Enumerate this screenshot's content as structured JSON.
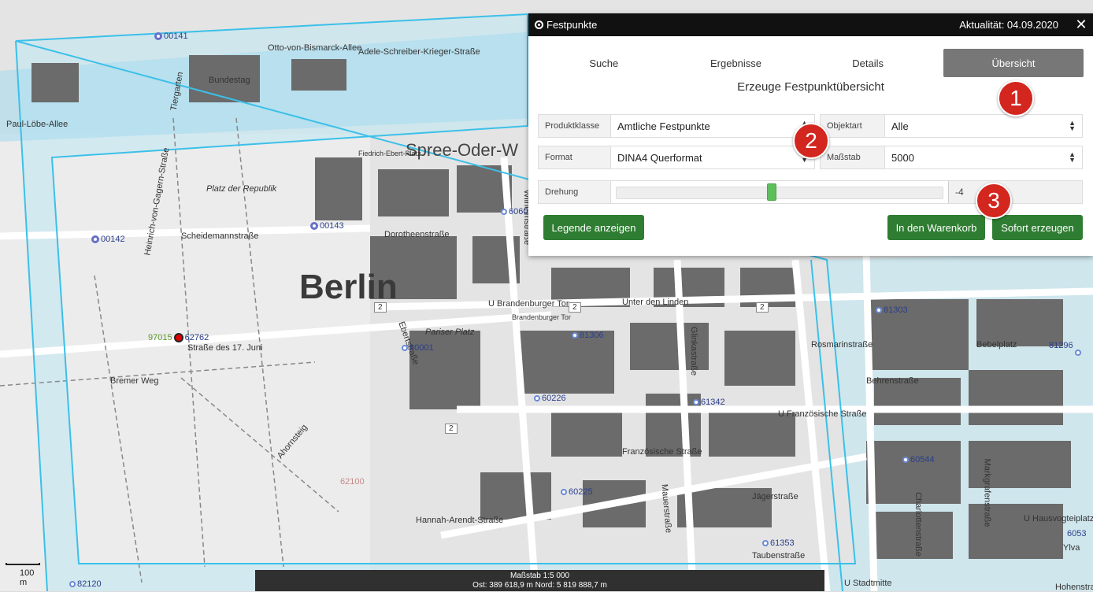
{
  "map": {
    "city_label": "Berlin",
    "street_labels": [
      "Paul-Löbe-Allee",
      "Scheidemannstraße",
      "Dorotheenstraße",
      "Straße des 17. Juni",
      "Bremer Weg",
      "Hannah-Arendt-Straße",
      "Französische Straße",
      "Jägerstraße",
      "Behrenstraße",
      "Unter den Linden",
      "Wilhelmstraße",
      "Spree-Oder-W",
      "Adele-Schreiber-Krieger-Straße",
      "Ebertstraße",
      "Glinkastraße",
      "Mauerstraße",
      "Taubenstraße",
      "Charlottenstraße",
      "Markgrafenstraße",
      "Bebelplatz",
      "Platz der Republik",
      "Bundestag",
      "Ahornsteig",
      "Fiedrich-Ebert-Platz",
      "Pariser Platz",
      "U Brandenburger Tor",
      "Brandenburger Tor",
      "U Französische Straße",
      "U Hausvogteiplatz",
      "U Stadtmitte",
      "Otto-von-Bismarck-Allee",
      "Tiergarten",
      "Heinrich-von-Gagern-Straße",
      "Hohenstraße",
      "Rosmarinstraße",
      "Ylva"
    ],
    "road_numbers": [
      "2",
      "2",
      "2",
      "2"
    ],
    "points": [
      {
        "id": "00141",
        "type": "large"
      },
      {
        "id": "00143",
        "type": "large"
      },
      {
        "id": "00142",
        "type": "large"
      },
      {
        "id": "62762",
        "type": "red"
      },
      {
        "id": "97015",
        "type": "green"
      },
      {
        "id": "80001",
        "type": "small"
      },
      {
        "id": "81306",
        "type": "small"
      },
      {
        "id": "81303",
        "type": "small"
      },
      {
        "id": "60226",
        "type": "small"
      },
      {
        "id": "61342",
        "type": "small"
      },
      {
        "id": "60225",
        "type": "small"
      },
      {
        "id": "60544",
        "type": "small"
      },
      {
        "id": "61353",
        "type": "small"
      },
      {
        "id": "81296",
        "type": "small"
      },
      {
        "id": "82120",
        "type": "small"
      },
      {
        "id": "6060",
        "type": "small"
      },
      {
        "id": "6053",
        "type": "small"
      },
      {
        "id": "62100",
        "type": "small"
      }
    ]
  },
  "panel": {
    "title": "Festpunkte",
    "date_info": "Aktualität: 04.09.2020",
    "close": "✕",
    "tabs": [
      {
        "label": "Suche",
        "active": false
      },
      {
        "label": "Ergebnisse",
        "active": false
      },
      {
        "label": "Details",
        "active": false
      },
      {
        "label": "Übersicht",
        "active": true
      }
    ],
    "section_title": "Erzeuge Festpunktübersicht",
    "fields": {
      "produktklasse": {
        "label": "Produktklasse",
        "value": "Amtliche Festpunkte"
      },
      "objektart": {
        "label": "Objektart",
        "value": "Alle"
      },
      "format": {
        "label": "Format",
        "value": "DINA4 Querformat"
      },
      "massstab": {
        "label": "Maßstab",
        "value": "5000"
      }
    },
    "drehung": {
      "label": "Drehung",
      "value": "-4",
      "slider_fraction": 0.475
    },
    "buttons": {
      "legende": "Legende anzeigen",
      "warenkorb": "In den Warenkorb",
      "sofort": "Sofort erzeugen"
    }
  },
  "markers": [
    "1",
    "2",
    "3"
  ],
  "status": {
    "scale": "Maßstab 1:5 000",
    "coords": "Ost: 389 618,9 m Nord: 5 819 888,7 m"
  },
  "scalebar": "100 m",
  "colors": {
    "accent_green": "#2e7d32",
    "marker_red": "#d3261f",
    "frame_blue": "#3cc0e8",
    "header_black": "#111111"
  }
}
